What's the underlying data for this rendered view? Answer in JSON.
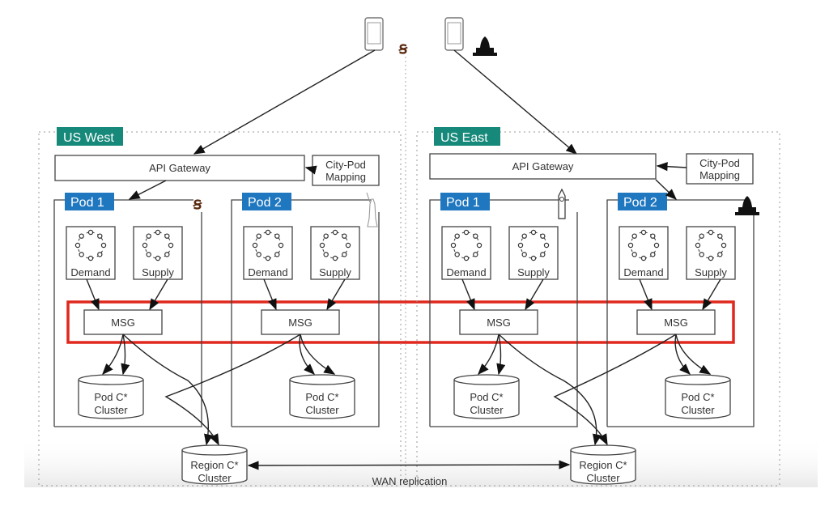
{
  "regions": [
    {
      "label": "US West",
      "label_color": "#17897a",
      "api_gateway": "API Gateway",
      "mapping": [
        "City-Pod",
        "Mapping"
      ],
      "pods": [
        {
          "label": "Pod 1",
          "city_icon": "sf-giants-logo-icon",
          "services": [
            "Demand",
            "Supply"
          ],
          "msg": "MSG",
          "db": [
            "Pod C*",
            "Cluster"
          ]
        },
        {
          "label": "Pod 2",
          "city_icon": "statue-of-liberty-icon",
          "services": [
            "Demand",
            "Supply"
          ],
          "msg": "MSG",
          "db": [
            "Pod C*",
            "Cluster"
          ]
        }
      ],
      "region_db": [
        "Region C*",
        "Cluster"
      ]
    },
    {
      "label": "US East",
      "label_color": "#17897a",
      "api_gateway": "API Gateway",
      "mapping": [
        "City-Pod",
        "Mapping"
      ],
      "pods": [
        {
          "label": "Pod 1",
          "city_icon": "big-ben-icon",
          "services": [
            "Demand",
            "Supply"
          ],
          "msg": "MSG",
          "db": [
            "Pod C*",
            "Cluster"
          ]
        },
        {
          "label": "Pod 2",
          "city_icon": "capitol-icon",
          "services": [
            "Demand",
            "Supply"
          ],
          "msg": "MSG",
          "db": [
            "Pod C*",
            "Cluster"
          ]
        }
      ],
      "region_db": [
        "Region C*",
        "Cluster"
      ]
    }
  ],
  "clients": [
    {
      "icon": "phone-icon",
      "city_icon": "sf-giants-logo-icon"
    },
    {
      "icon": "phone-icon",
      "city_icon": "capitol-icon"
    }
  ],
  "replication_label": "WAN replication",
  "colors": {
    "pod_label": "#1f77c0",
    "highlight": "#e0281e",
    "region_label": "#17897a"
  }
}
